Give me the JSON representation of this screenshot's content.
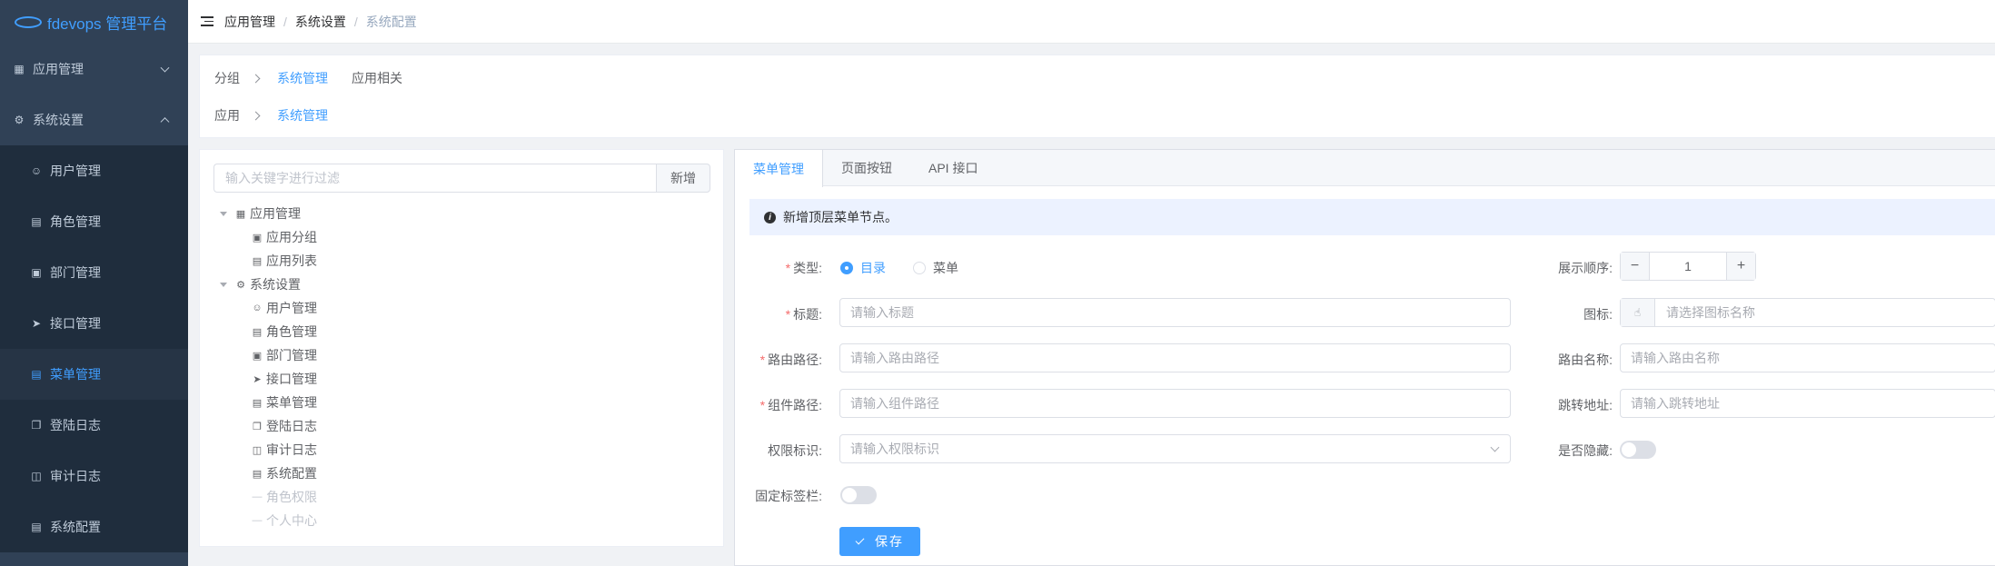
{
  "app": {
    "logo_text": "fdevops 管理平台"
  },
  "sidebar": {
    "items": [
      {
        "label": "应用管理",
        "icon": "grid-icon"
      },
      {
        "label": "系统设置",
        "icon": "gear-icon"
      },
      {
        "label": "用户管理",
        "icon": "user-icon"
      },
      {
        "label": "角色管理",
        "icon": "role-icon"
      },
      {
        "label": "部门管理",
        "icon": "dept-icon"
      },
      {
        "label": "接口管理",
        "icon": "send-icon"
      },
      {
        "label": "菜单管理",
        "icon": "menu-icon"
      },
      {
        "label": "登陆日志",
        "icon": "copy-icon"
      },
      {
        "label": "审计日志",
        "icon": "book-icon"
      },
      {
        "label": "系统配置",
        "icon": "document-icon"
      }
    ]
  },
  "breadcrumb": [
    "应用管理",
    "系统设置",
    "系统配置"
  ],
  "group_filter": {
    "group_label": "分组",
    "group_options": [
      "系统管理",
      "应用相关"
    ],
    "app_label": "应用",
    "app_options": [
      "系统管理"
    ]
  },
  "tree": {
    "filter_placeholder": "输入关键字进行过滤",
    "add_label": "新增",
    "nodes": [
      "应用管理",
      "应用分组",
      "应用列表",
      "系统设置",
      "用户管理",
      "角色管理",
      "部门管理",
      "接口管理",
      "菜单管理",
      "登陆日志",
      "审计日志",
      "系统配置",
      "角色权限",
      "个人中心"
    ]
  },
  "tabs": [
    "菜单管理",
    "页面按钮",
    "API 接口"
  ],
  "alert": {
    "text": "新增顶层菜单节点。"
  },
  "form": {
    "type_label": "类型:",
    "type_options": [
      "目录",
      "菜单"
    ],
    "title_label": "标题:",
    "title_placeholder": "请输入标题",
    "route_path_label": "路由路径:",
    "route_path_placeholder": "请输入路由路径",
    "component_label": "组件路径:",
    "component_placeholder": "请输入组件路径",
    "permission_label": "权限标识:",
    "permission_placeholder": "请输入权限标识",
    "fixed_tag_label": "固定标签栏:",
    "order_label": "展示顺序:",
    "order_value": "1",
    "icon_label": "图标:",
    "icon_placeholder": "请选择图标名称",
    "route_name_label": "路由名称:",
    "route_name_placeholder": "请输入路由名称",
    "redirect_label": "跳转地址:",
    "redirect_placeholder": "请输入跳转地址",
    "hidden_label": "是否隐藏:",
    "save_label": "保存"
  },
  "colors": {
    "accent": "#409eff",
    "sidebar_bg": "#304156",
    "alert_bg": "#ecf2ff"
  }
}
